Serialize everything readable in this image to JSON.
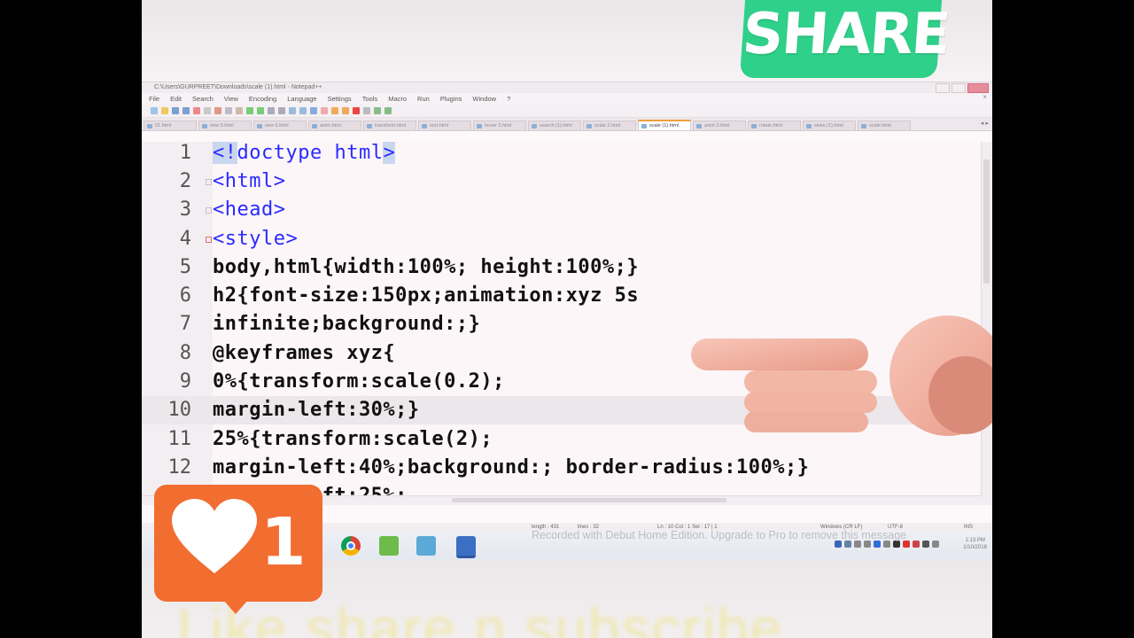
{
  "overlay": {
    "share_label": "SHARE",
    "like_count": "1",
    "bottom_caption": "Like share n subscribe",
    "watermark": "Recorded with Debut Home Edition. Upgrade to Pro to remove this message"
  },
  "window": {
    "title": "C:\\Users\\GURPREET\\Downloads\\scale (1).html - Notepad++"
  },
  "menu": [
    "File",
    "Edit",
    "Search",
    "View",
    "Encoding",
    "Language",
    "Settings",
    "Tools",
    "Macro",
    "Run",
    "Plugins",
    "Window",
    "?"
  ],
  "tabs": [
    {
      "label": "01.html"
    },
    {
      "label": "new 5.html"
    },
    {
      "label": "new 6.html"
    },
    {
      "label": "anim.html"
    },
    {
      "label": "transform.html"
    },
    {
      "label": "sort.html"
    },
    {
      "label": "hover 2.html"
    },
    {
      "label": "search (1).html"
    },
    {
      "label": "scale 2.html"
    },
    {
      "label": "scale (1).html",
      "active": true
    },
    {
      "label": "anim 3.html"
    },
    {
      "label": "rotate.html"
    },
    {
      "label": "skew (1).html"
    },
    {
      "label": "scale.html"
    }
  ],
  "code_lines": [
    {
      "num": "1",
      "text": "<!doctype html>",
      "kind": "tag"
    },
    {
      "num": "2",
      "text": "<html>",
      "kind": "tag"
    },
    {
      "num": "3",
      "text": "<head>",
      "kind": "tag"
    },
    {
      "num": "4",
      "text": "<style>",
      "kind": "tag"
    },
    {
      "num": "5",
      "text": "body,html{width:100%; height:100%;}",
      "kind": "css"
    },
    {
      "num": "6",
      "text": "h2{font-size:150px;animation:xyz 5s",
      "kind": "css"
    },
    {
      "num": "7",
      "text": "infinite;background:;}",
      "kind": "css"
    },
    {
      "num": "8",
      "text": "@keyframes xyz{",
      "kind": "css"
    },
    {
      "num": "9",
      "text": "0%{transform:scale(0.2);",
      "kind": "css"
    },
    {
      "num": "10",
      "text": "margin-left:30%;}",
      "kind": "css",
      "current": true
    },
    {
      "num": "11",
      "text": "25%{transform:scale(2);",
      "kind": "css"
    },
    {
      "num": "12",
      "text": "margin-left:40%;background:; border-radius:100%;}",
      "kind": "css"
    },
    {
      "num": "13",
      "text": "margin-left:25%;",
      "kind": "css"
    }
  ],
  "status": {
    "length": "length : 431",
    "lines": "lines : 32",
    "position": "Ln : 10   Col : 1   Sel : 17 | 1",
    "eol": "Windows (CR LF)",
    "encoding": "UTF-8",
    "mode": "INS"
  },
  "taskbar": {
    "time": "1:13 PM",
    "date": "1/10/2018"
  },
  "colors": {
    "share_green": "#2fd08a",
    "like_orange": "#f26d30",
    "tag_blue": "#2a2aff",
    "caption_yellow": "#efe6a0"
  },
  "icons": [
    "heart-icon",
    "pointing-hand-icon",
    "chrome-icon",
    "notepad-icon",
    "save-icon"
  ]
}
